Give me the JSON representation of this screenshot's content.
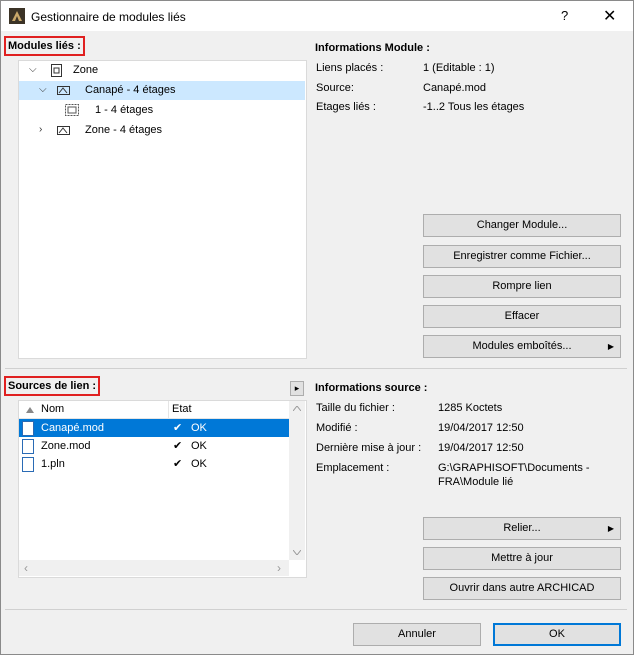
{
  "window": {
    "title": "Gestionnaire de modules liés",
    "help": "?",
    "close": "✕"
  },
  "modules": {
    "section_title": "Modules liés :",
    "tree": [
      {
        "label": "Zone",
        "chevron": "⌵"
      },
      {
        "label": "Canapé - 4 étages",
        "chevron": "⌵"
      },
      {
        "label": "1 - 4 étages"
      },
      {
        "label": "Zone - 4 étages",
        "chevron": "›"
      }
    ]
  },
  "module_info": {
    "title": "Informations Module :",
    "placed_label": "Liens placés :",
    "placed_value": "1 (Editable : 1)",
    "source_label": "Source:",
    "source_value": "Canapé.mod",
    "floors_label": "Etages liés :",
    "floors_value": "-1..2 Tous les étages"
  },
  "module_buttons": {
    "change": "Changer Module...",
    "save": "Enregistrer comme Fichier...",
    "break": "Rompre lien",
    "delete": "Effacer",
    "nested": "Modules emboîtés..."
  },
  "sources": {
    "section_title": "Sources de lien :",
    "expand_arrow": "▸",
    "col_name": "Nom",
    "col_state": "Etat",
    "rows": [
      {
        "name": "Canapé.mod",
        "state": "OK",
        "check": "✔"
      },
      {
        "name": "Zone.mod",
        "state": "OK",
        "check": "✔"
      },
      {
        "name": "1.pln",
        "state": "OK",
        "check": "✔"
      }
    ],
    "scroll_left": "‹",
    "scroll_right": "›"
  },
  "source_info": {
    "title": "Informations source :",
    "size_label": "Taille du fichier :",
    "size_value": "1285 Koctets",
    "modified_label": "Modifié :",
    "modified_value": "19/04/2017 12:50",
    "updated_label": "Dernière mise à jour :",
    "updated_value": "19/04/2017 12:50",
    "location_label": "Emplacement :",
    "location_value_1": "G:\\GRAPHISOFT\\Documents -",
    "location_value_2": "FRA\\Module lié"
  },
  "source_buttons": {
    "link": "Relier...",
    "update": "Mettre à jour",
    "open": "Ouvrir dans autre ARCHICAD"
  },
  "footer": {
    "cancel": "Annuler",
    "ok": "OK"
  }
}
